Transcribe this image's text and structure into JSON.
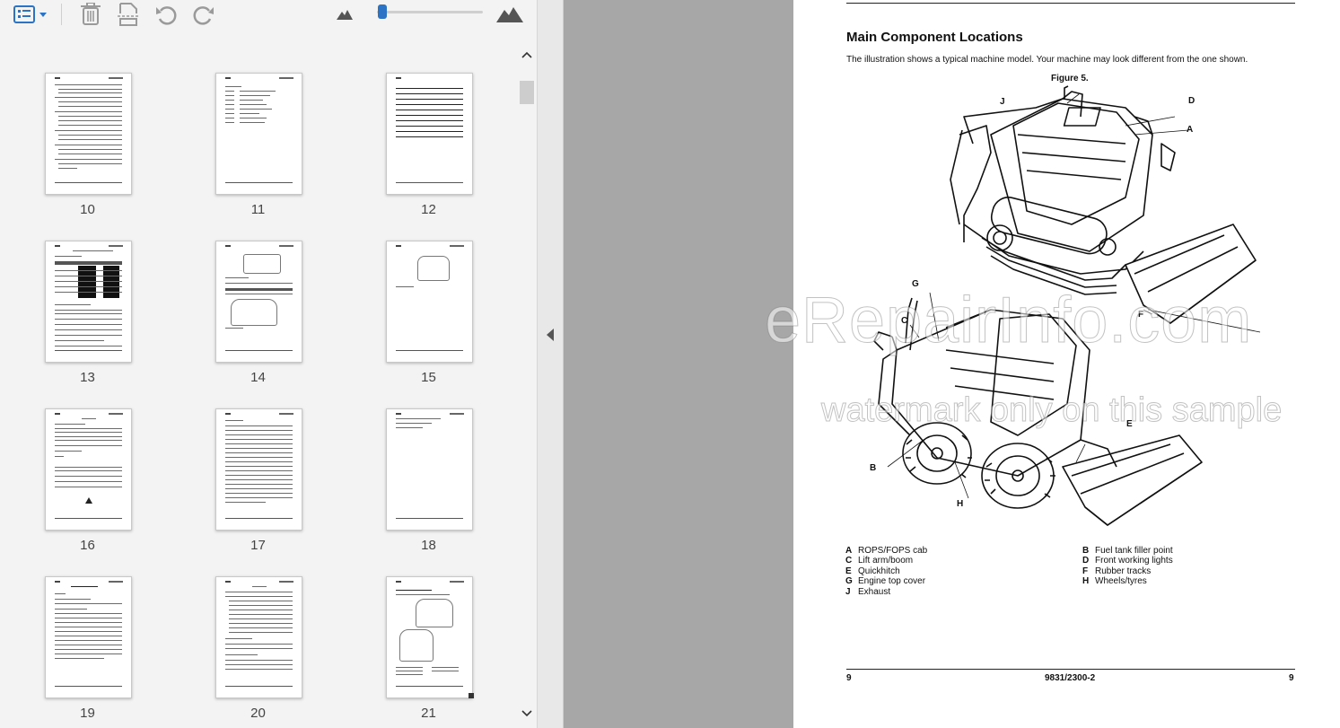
{
  "toolbar": {
    "icons": [
      "thumbnail-view-icon",
      "delete-icon",
      "extract-icon",
      "undo-icon",
      "redo-icon",
      "zoom-out-icon",
      "zoom-in-icon"
    ],
    "accent": "#2a73c5"
  },
  "thumbnails": [
    {
      "page": "10",
      "kind": "toc"
    },
    {
      "page": "11",
      "kind": "list"
    },
    {
      "page": "12",
      "kind": "ruled"
    },
    {
      "page": "13",
      "kind": "table"
    },
    {
      "page": "14",
      "kind": "figure"
    },
    {
      "page": "15",
      "kind": "figure-small"
    },
    {
      "page": "16",
      "kind": "text"
    },
    {
      "page": "17",
      "kind": "text"
    },
    {
      "page": "18",
      "kind": "blank"
    },
    {
      "page": "19",
      "kind": "text"
    },
    {
      "page": "20",
      "kind": "text"
    },
    {
      "page": "21",
      "kind": "machines"
    }
  ],
  "document": {
    "title": "Main Component Locations",
    "intro": "The illustration shows a typical machine model. Your machine may look different from the one shown.",
    "figure_label": "Figure 5.",
    "callouts": [
      "J",
      "D",
      "A",
      "G",
      "C",
      "F",
      "E",
      "B",
      "H"
    ],
    "legend": [
      {
        "key": "A",
        "text": "ROPS/FOPS cab"
      },
      {
        "key": "C",
        "text": "Lift arm/boom"
      },
      {
        "key": "E",
        "text": "Quickhitch"
      },
      {
        "key": "G",
        "text": "Engine top cover"
      },
      {
        "key": "J",
        "text": "Exhaust"
      },
      {
        "key": "B",
        "text": "Fuel tank filler point"
      },
      {
        "key": "D",
        "text": "Front working lights"
      },
      {
        "key": "F",
        "text": "Rubber tracks"
      },
      {
        "key": "H",
        "text": "Wheels/tyres"
      }
    ],
    "footer_left": "9",
    "footer_center": "9831/2300-2",
    "footer_right": "9"
  },
  "watermark": {
    "main": "eRepairInfo.com",
    "sub": "watermark only on this sample"
  }
}
